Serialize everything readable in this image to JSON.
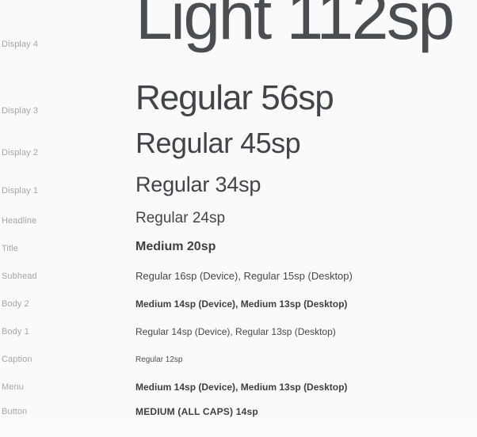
{
  "sheet": {
    "background_color": "#fafafa",
    "label_color": "#a6a6a6",
    "sample_color": "#41454a",
    "rows": [
      {
        "label": "Display 4",
        "sample": "Light 112sp"
      },
      {
        "label": "Display 3",
        "sample": "Regular 56sp"
      },
      {
        "label": "Display 2",
        "sample": "Regular 45sp"
      },
      {
        "label": "Display 1",
        "sample": "Regular 34sp"
      },
      {
        "label": "Headline",
        "sample": "Regular 24sp"
      },
      {
        "label": "Title",
        "sample": "Medium 20sp"
      },
      {
        "label": "Subhead",
        "sample": "Regular 16sp (Device), Regular 15sp (Desktop)"
      },
      {
        "label": "Body 2",
        "sample": "Medium 14sp (Device), Medium 13sp (Desktop)"
      },
      {
        "label": "Body 1",
        "sample": "Regular 14sp (Device), Regular 13sp (Desktop)"
      },
      {
        "label": "Caption",
        "sample": "Regular 12sp"
      },
      {
        "label": "Menu",
        "sample": "Medium 14sp (Device), Medium 13sp (Desktop)"
      },
      {
        "label": "Button",
        "sample": "MEDIUM (ALL CAPS) 14sp"
      }
    ]
  }
}
